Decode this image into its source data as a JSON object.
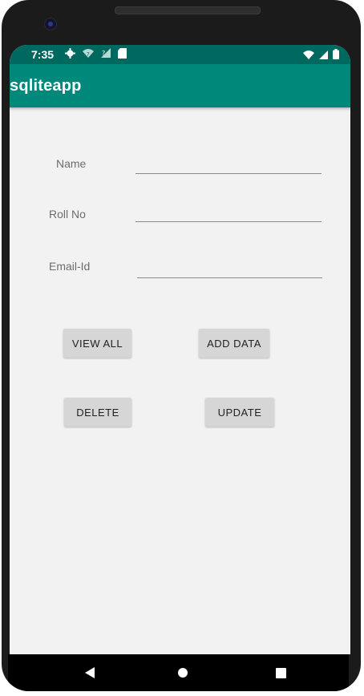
{
  "status_bar": {
    "time": "7:35",
    "left_icons": [
      "gear-icon",
      "wifi-question-icon",
      "signal-question-icon",
      "sd-card-icon"
    ],
    "right_icons": [
      "wifi-icon",
      "signal-icon",
      "battery-icon"
    ]
  },
  "app_bar": {
    "title": "sqliteapp",
    "color": "#00897b",
    "status_color": "#00695f"
  },
  "form": {
    "name_label": "Name",
    "name_value": "",
    "roll_label": "Roll No",
    "roll_value": "",
    "email_label": "Email-Id",
    "email_value": ""
  },
  "buttons": {
    "view_all": "VIEW ALL",
    "add_data": "ADD DATA",
    "delete": "DELETE",
    "update": "UPDATE"
  },
  "nav_bar": {
    "icons": [
      "back-icon",
      "home-icon",
      "recents-icon"
    ]
  }
}
